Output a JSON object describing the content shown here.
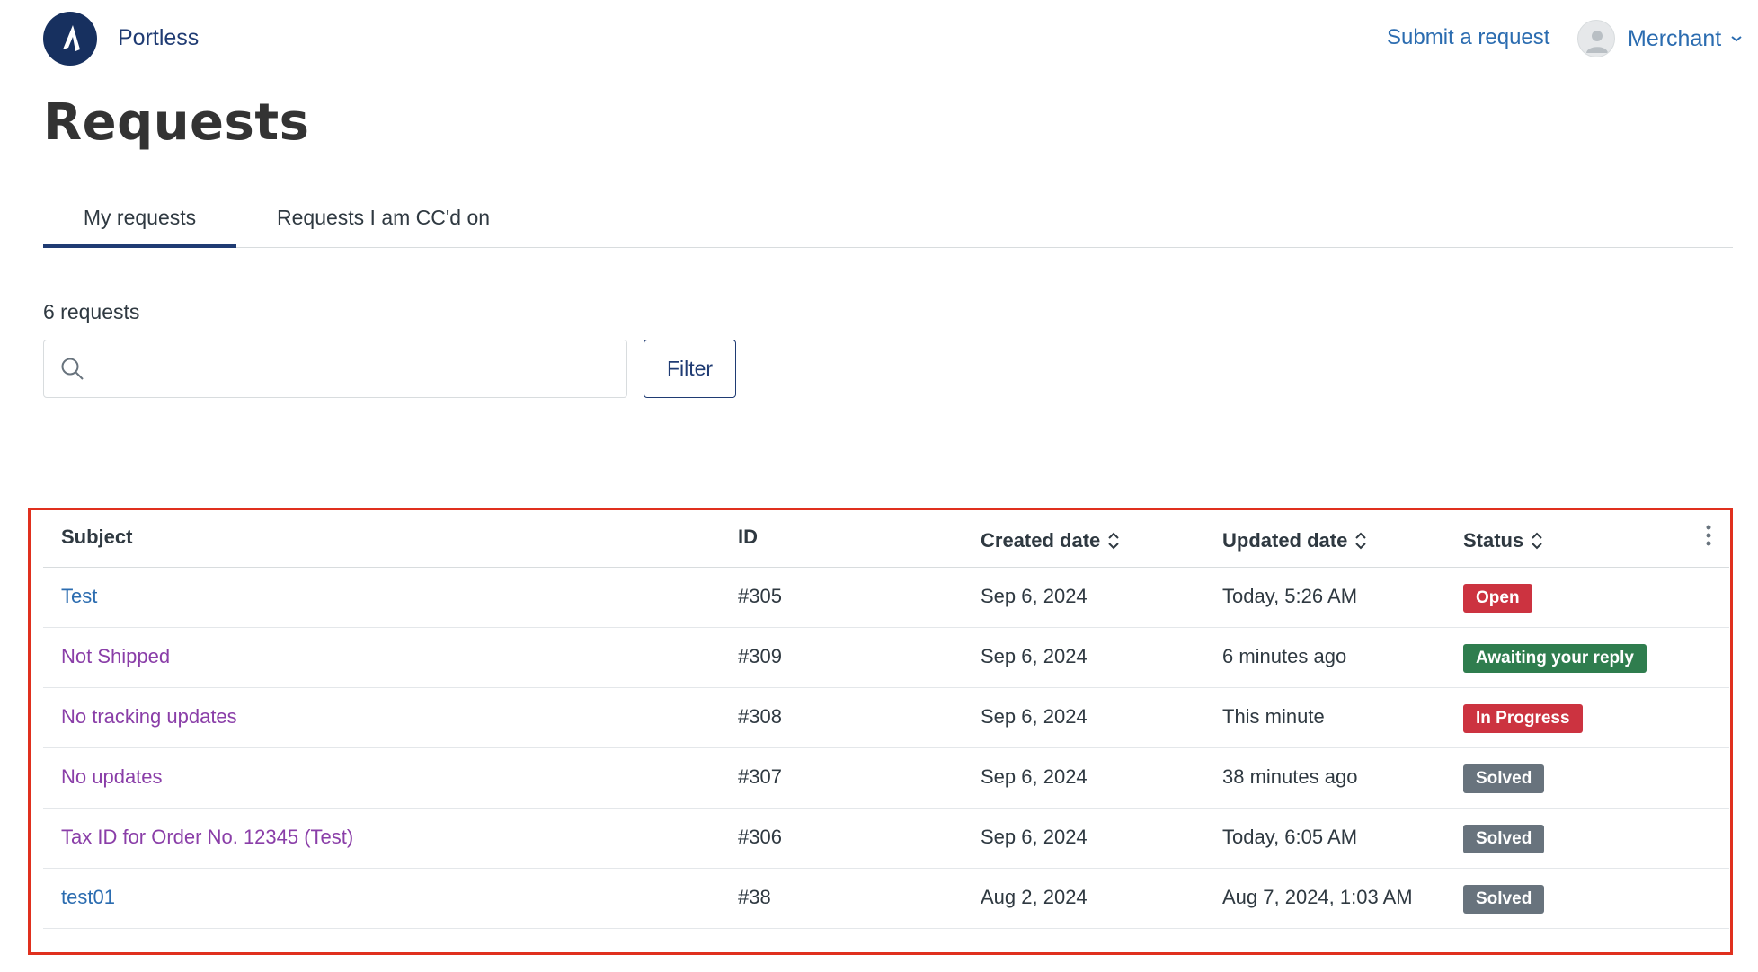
{
  "header": {
    "brand": "Portless",
    "submit_request": "Submit a request",
    "user_name": "Merchant"
  },
  "page": {
    "title": "Requests"
  },
  "tabs": [
    {
      "label": "My requests",
      "active": true
    },
    {
      "label": "Requests I am CC'd on",
      "active": false
    }
  ],
  "count_text": "6 requests",
  "search": {
    "value": "",
    "placeholder": ""
  },
  "filter_label": "Filter",
  "table": {
    "headers": {
      "subject": "Subject",
      "id": "ID",
      "created": "Created date",
      "updated": "Updated date",
      "status": "Status"
    },
    "rows": [
      {
        "subject": "Test",
        "id": "#305",
        "created": "Sep 6, 2024",
        "updated": "Today, 5:26 AM",
        "status": "Open",
        "status_color": "#cc3340",
        "visited": false
      },
      {
        "subject": "Not Shipped",
        "id": "#309",
        "created": "Sep 6, 2024",
        "updated": "6 minutes ago",
        "status": "Awaiting your reply",
        "status_color": "#2f7d4e",
        "visited": true
      },
      {
        "subject": "No tracking updates",
        "id": "#308",
        "created": "Sep 6, 2024",
        "updated": "This minute",
        "status": "In Progress",
        "status_color": "#cc3340",
        "visited": true
      },
      {
        "subject": "No updates",
        "id": "#307",
        "created": "Sep 6, 2024",
        "updated": "38 minutes ago",
        "status": "Solved",
        "status_color": "#68737d",
        "visited": true
      },
      {
        "subject": "Tax ID for Order No. 12345 (Test)",
        "id": "#306",
        "created": "Sep 6, 2024",
        "updated": "Today, 6:05 AM",
        "status": "Solved",
        "status_color": "#68737d",
        "visited": true
      },
      {
        "subject": "test01",
        "id": "#38",
        "created": "Aug 2, 2024",
        "updated": "Aug 7, 2024, 1:03 AM",
        "status": "Solved",
        "status_color": "#68737d",
        "visited": false
      }
    ]
  },
  "colors": {
    "brand_navy": "#17305f",
    "link_blue": "#2b6cb0",
    "visited_purple": "#8a3ea8",
    "highlight_frame": "#e0301e"
  }
}
